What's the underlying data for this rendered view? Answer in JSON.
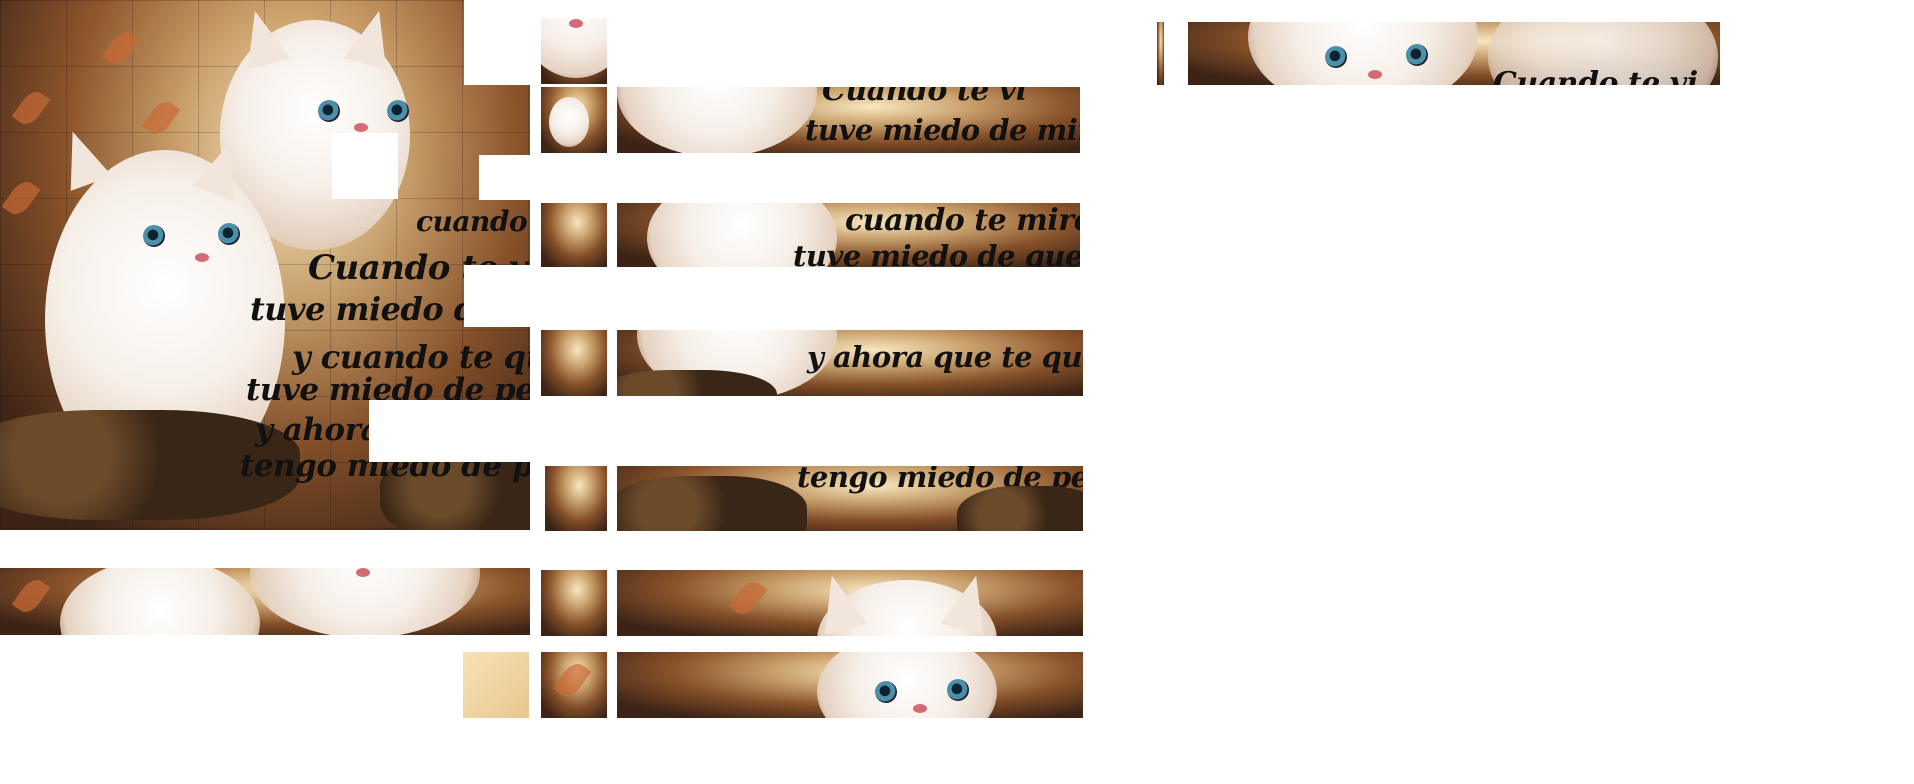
{
  "puzzle": {
    "poem_lines": [
      "Cuando te vi",
      "tuve miedo de mirarte,",
      "cuando te mire",
      "tuve miedo de quererte,",
      "y cuando te quiero",
      "tuve miedo de perderte",
      "y ahora que te quiero",
      "tengo miedo de perderte"
    ]
  }
}
